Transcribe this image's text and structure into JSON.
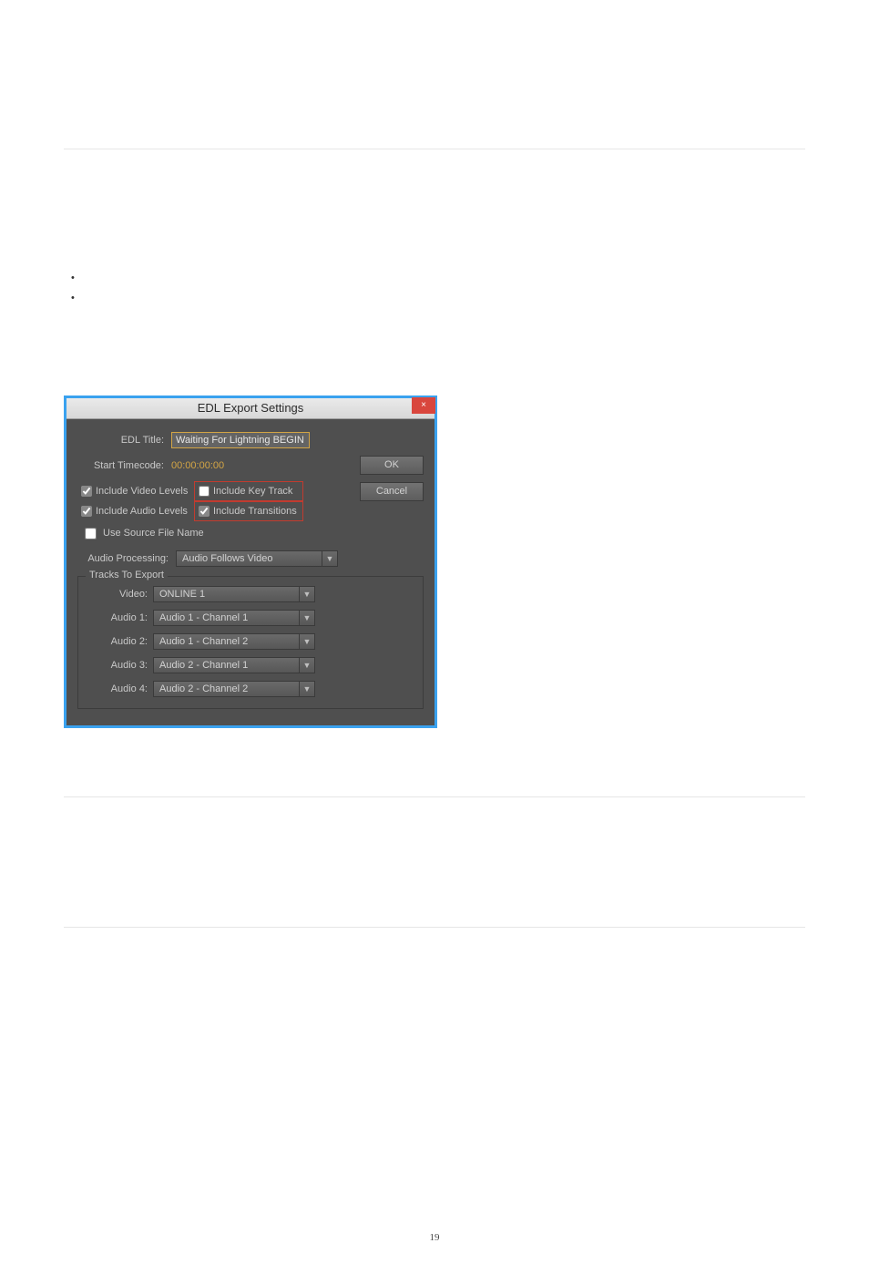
{
  "page_number": "19",
  "dialog": {
    "title": "EDL Export Settings",
    "buttons": {
      "ok": "OK",
      "cancel": "Cancel",
      "close_glyph": "×"
    },
    "edl_title_label": "EDL Title:",
    "edl_title_value": "Waiting For Lightning BEGIN",
    "start_tc_label": "Start Timecode:",
    "start_tc_value": "00:00:00:00",
    "checks": {
      "video_levels": "Include Video Levels",
      "audio_levels": "Include Audio Levels",
      "key_track": "Include Key Track",
      "transitions": "Include Transitions",
      "use_source": "Use Source File Name"
    },
    "check_values": {
      "video_levels": true,
      "audio_levels": true,
      "key_track": false,
      "transitions": true,
      "use_source": false
    },
    "audio_processing_label": "Audio Processing:",
    "audio_processing_value": "Audio Follows Video",
    "tracks_legend": "Tracks To Export",
    "tracks": {
      "video_label": "Video:",
      "video_value": "ONLINE 1",
      "a1_label": "Audio 1:",
      "a1_value": "Audio 1 - Channel 1",
      "a2_label": "Audio 2:",
      "a2_value": "Audio 1 - Channel 2",
      "a3_label": "Audio 3:",
      "a3_value": "Audio 2 - Channel 1",
      "a4_label": "Audio 4:",
      "a4_value": "Audio 2 - Channel 2"
    }
  }
}
